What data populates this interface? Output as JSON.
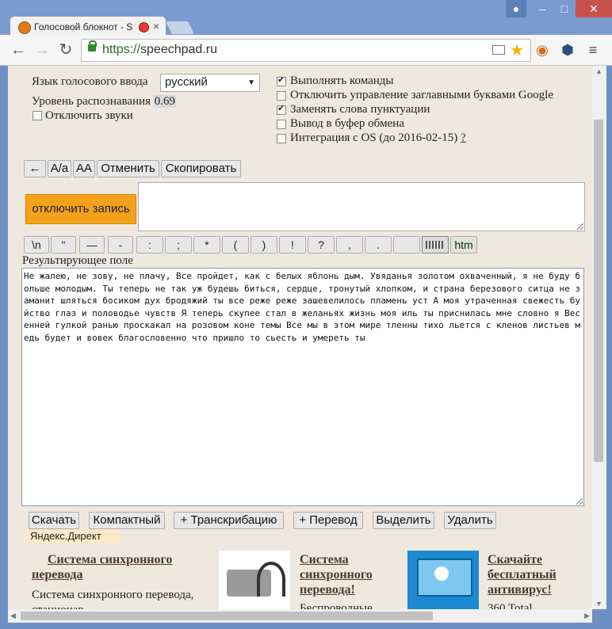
{
  "browser": {
    "tab_title": "Голосовой блокнот - S",
    "tab_close": "×",
    "url_scheme": "https://",
    "url_host": "speechpad.ru",
    "back": "←",
    "forward": "→",
    "reload": "↻",
    "star": "★",
    "menu": "≡",
    "win_min": "–",
    "win_max": "□",
    "win_close": "✕"
  },
  "settings": {
    "lang_label": "Язык голосового ввода",
    "lang_value": "русский",
    "confidence_label": "Уровень распознавания",
    "confidence_value": "0.69",
    "mute_label": "Отключить звуки",
    "options": [
      {
        "label": "Выполнять команды",
        "checked": true
      },
      {
        "label": "Отключить управление заглавными буквами Google",
        "checked": false
      },
      {
        "label": "Заменять слова пунктуации",
        "checked": true
      },
      {
        "label": "Вывод в буфер обмена",
        "checked": false
      },
      {
        "label": "Интеграция с OS (до 2016-02-15)",
        "checked": false
      }
    ],
    "help_link": "?"
  },
  "edit_buttons": {
    "back": "←",
    "case_toggle": "A/a",
    "upper": "AA",
    "undo": "Отменить",
    "copy": "Скопировать"
  },
  "record_button": "отключить запись",
  "punct_buttons": [
    "\\n",
    "\"",
    "—",
    "-",
    ":",
    ";",
    "*",
    "(",
    ")",
    "!",
    "?",
    ",",
    ".",
    "",
    "htm"
  ],
  "result": {
    "label": "Результирующее поле",
    "text": "Не жалею, не зову, не плачу, Все пройдет, как с белых яблонь дым. Увяданья золотом охваченный, я не буду больше молодым. Ты теперь не так уж будешь биться, сердце, тронутый хлопком, и страна березового ситца не заманит шляться босиком дух бродяжий ты все реже реже зашевелилось пламень уст А моя утраченная свежесть буйство глаз и половодье чувств Я теперь скупее стал в желаньях жизнь моя иль ты приснилась мне словно я Весенней гулкой ранью проскакал на розовом коне темы Все мы в этом мире тленны тихо льется с кленов листьев медь будет и вовек благословенно что пришло то сьесть и умереть ты"
  },
  "action_buttons": [
    "Скачать",
    "Компактный",
    "+ Транскрибацию",
    "+ Перевод",
    "Выделить",
    "Удалить"
  ],
  "ads": {
    "source": "Яндекс.Директ",
    "ad1_title": "Система синхронного перевода",
    "ad1_text": "Система синхронного перевода, стационар",
    "ad2_title": "Система синхронного перевода!",
    "ad2_text": "Беспроводные",
    "ad3_title": "Скачайте бесплатный антивирус!",
    "ad3_text": "360 Total"
  }
}
